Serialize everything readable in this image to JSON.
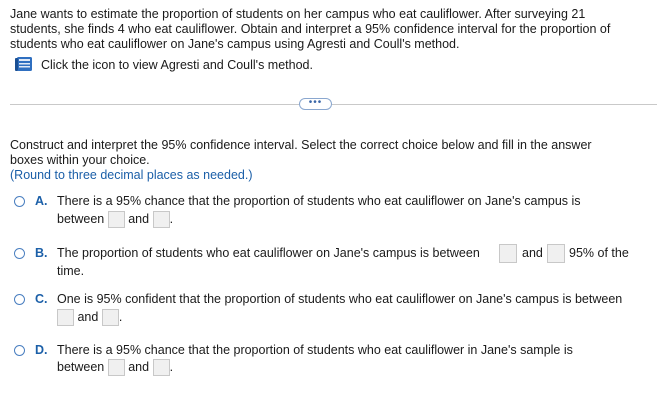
{
  "question": {
    "line1": "Jane wants to estimate the proportion of students on her campus who eat cauliflower. After surveying 21",
    "line2": "students, she finds 4 who eat cauliflower. Obtain and interpret a 95% confidence interval for the proportion of",
    "line3": "students who eat cauliflower on Jane's campus using Agresti and Coull's method.",
    "link_text": "Click the icon to view Agresti and Coull's method."
  },
  "divider": {
    "button_label": "•••"
  },
  "instructions": {
    "line1": "Construct and interpret the 95% confidence interval. Select the correct choice below and fill in the answer",
    "line2": "boxes within your choice.",
    "rounding": "(Round to three decimal places as needed.)"
  },
  "choices": {
    "a": {
      "letter": "A.",
      "line1": "There is a 95% chance that the proportion of students who eat cauliflower on Jane's campus is",
      "between": "between",
      "and": "and",
      "end": "."
    },
    "b": {
      "letter": "B.",
      "text": "The proportion of students who eat cauliflower on Jane's campus is between",
      "and": "and",
      "after": "95% of the",
      "line2": "time."
    },
    "c": {
      "letter": "C.",
      "line1": "One is 95% confident that the proportion of students who eat cauliflower on Jane's campus is between",
      "and": "and",
      "end": "."
    },
    "d": {
      "letter": "D.",
      "line1": "There is a 95% chance that the proportion of students who eat cauliflower in Jane's sample is",
      "between": "between",
      "and": "and",
      "end": "."
    }
  }
}
